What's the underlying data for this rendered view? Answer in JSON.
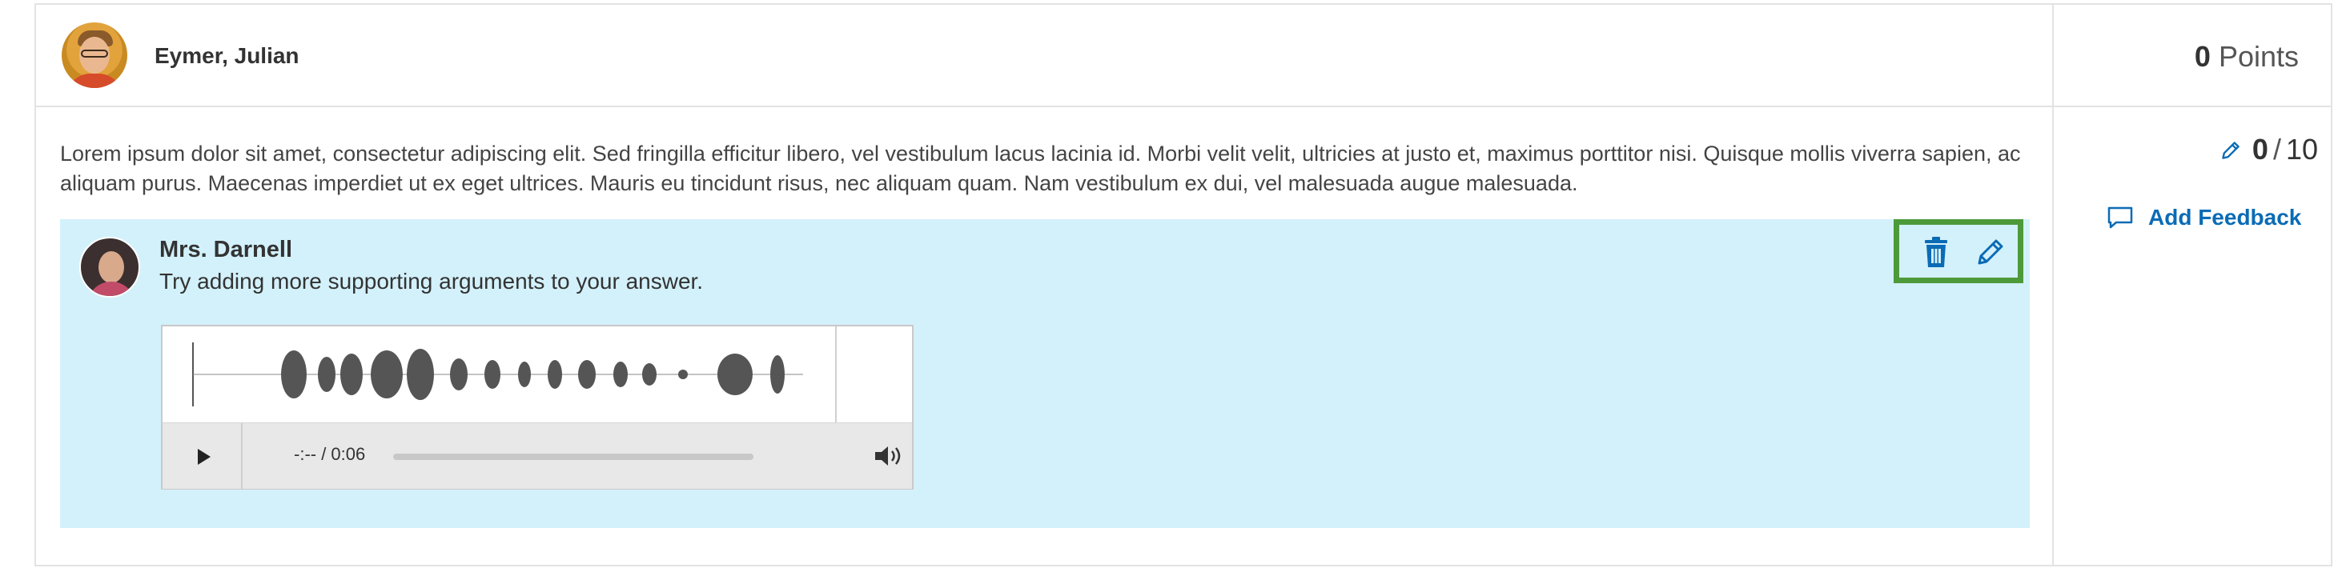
{
  "student": {
    "name": "Eymer, Julian"
  },
  "points_header": {
    "value": "0",
    "label": "Points"
  },
  "answer": {
    "text": "Lorem ipsum dolor sit amet, consectetur adipiscing elit. Sed fringilla efficitur libero, vel vestibulum lacus lacinia id. Morbi velit velit, ultricies at justo et, maximus porttitor nisi. Quisque mollis viverra sapien, ac aliquam purus. Maecenas imperdiet ut ex eget ultrices. Mauris eu tincidunt risus, nec aliquam quam. Nam vestibulum ex dui, vel malesuada augue malesuada."
  },
  "feedback": {
    "author": "Mrs. Darnell",
    "comment": "Try adding more supporting arguments to your answer.",
    "audio": {
      "time": "-:-- / 0:06"
    },
    "actions": {
      "delete_icon": "trash-icon",
      "edit_icon": "pencil-icon"
    }
  },
  "score": {
    "value": "0",
    "separator": "/",
    "max": "10"
  },
  "add_feedback": {
    "label": "Add Feedback",
    "icon": "comment-icon"
  },
  "colors": {
    "accent": "#0b6bb5",
    "feedback_bg": "#d3f1fb",
    "highlight_border": "#4d9a3a"
  }
}
